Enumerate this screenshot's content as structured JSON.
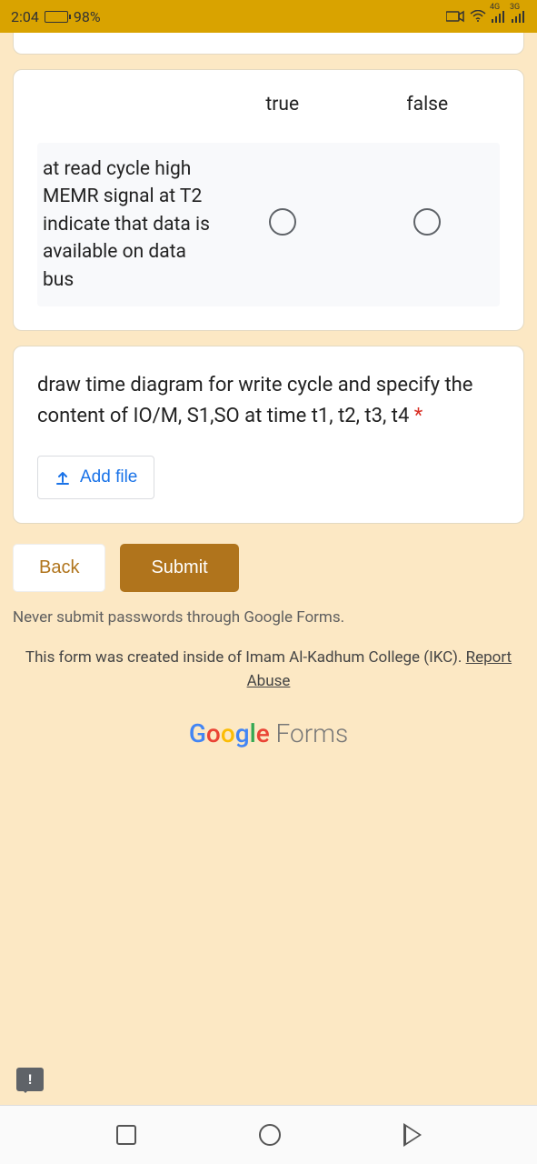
{
  "status": {
    "time": "2:04",
    "battery_pct": "98%",
    "net1": "4G",
    "net2": "3G"
  },
  "q1": {
    "col_true": "true",
    "col_false": "false",
    "row_label": "at read cycle high MEMR signal at T2 indicate that data is available on data bus"
  },
  "q2": {
    "text": "draw time diagram for write cycle and specify the content of IO/M, S1,SO at time t1, t2, t3, t4 ",
    "required": "*",
    "add_file": "Add file"
  },
  "buttons": {
    "back": "Back",
    "submit": "Submit"
  },
  "footer": {
    "warn": "Never submit passwords through Google Forms.",
    "created_pre": "This form was created inside of Imam Al-Kadhum College (IKC). ",
    "report": "Report Abuse",
    "forms": " Forms"
  }
}
